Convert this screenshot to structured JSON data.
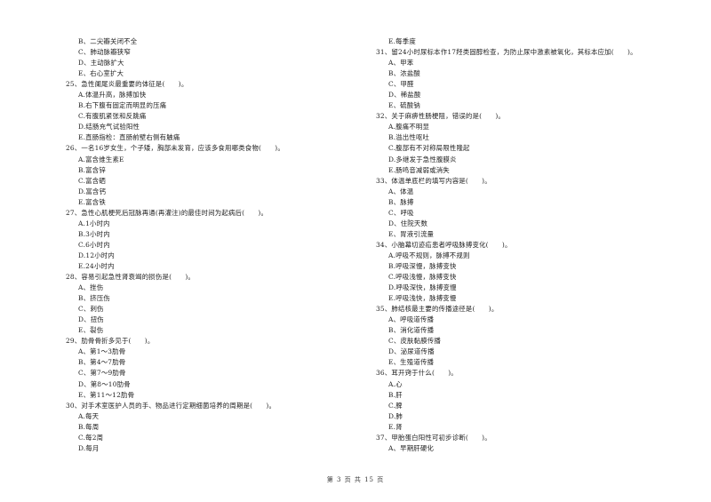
{
  "page": {
    "left_column": [
      {
        "type": "option",
        "text": "B、二尖瓣关闭不全"
      },
      {
        "type": "option",
        "text": "C、肺动脉瓣狭窄"
      },
      {
        "type": "option",
        "text": "D、主动脉扩大"
      },
      {
        "type": "option",
        "text": "E、右心室扩大"
      },
      {
        "type": "question",
        "text": "25、急性阑尾炎最重要的体征是(　　)。"
      },
      {
        "type": "option",
        "text": "A.体温升高，脉搏加快"
      },
      {
        "type": "option",
        "text": "B.右下腹有固定而明显的压痛"
      },
      {
        "type": "option",
        "text": "C.有腹肌紧张和反跳痛"
      },
      {
        "type": "option",
        "text": "D.结肠充气试验阳性"
      },
      {
        "type": "option",
        "text": "E.直肠指检：直肠前壁右侧有触痛"
      },
      {
        "type": "question",
        "text": "26、一名16岁女生，个子矮，胸部未发育，应该多食用哪类食物(　　)。"
      },
      {
        "type": "option",
        "text": "A.富含维生素E"
      },
      {
        "type": "option",
        "text": "B.富含锌"
      },
      {
        "type": "option",
        "text": "C.富含硒"
      },
      {
        "type": "option",
        "text": "D.富含钙"
      },
      {
        "type": "option",
        "text": "E.富含铁"
      },
      {
        "type": "question",
        "text": "27、急性心肌梗死后冠脉再通(再灌注)的最佳时间为起病后(　　)。"
      },
      {
        "type": "option",
        "text": "A.1小时内"
      },
      {
        "type": "option",
        "text": "B.3小时内"
      },
      {
        "type": "option",
        "text": "C.6小时内"
      },
      {
        "type": "option",
        "text": "D.12小时内"
      },
      {
        "type": "option",
        "text": "E.24小时内"
      },
      {
        "type": "question",
        "text": "28、容易引起急性肾衰竭的损伤是(　　)。"
      },
      {
        "type": "option",
        "text": "A、挫伤"
      },
      {
        "type": "option",
        "text": "B、挤压伤"
      },
      {
        "type": "option",
        "text": "C、刺伤"
      },
      {
        "type": "option",
        "text": "D、扭伤"
      },
      {
        "type": "option",
        "text": "E、裂伤"
      },
      {
        "type": "question",
        "text": "29、肋骨骨折多见于(　　)。"
      },
      {
        "type": "option",
        "text": "A、第1～3肋骨"
      },
      {
        "type": "option",
        "text": "B、第4～7肋骨"
      },
      {
        "type": "option",
        "text": "C、第7～9肋骨"
      },
      {
        "type": "option",
        "text": "D、第8～10肋骨"
      },
      {
        "type": "option",
        "text": "E、第11～12肋骨"
      },
      {
        "type": "question",
        "text": "30、对手术室医护人员的手、物品进行定期细菌培养的周期是(　　)。"
      },
      {
        "type": "option",
        "text": "A.每天"
      },
      {
        "type": "option",
        "text": "B.每周"
      },
      {
        "type": "option",
        "text": "C.每2周"
      },
      {
        "type": "option",
        "text": "D.每月"
      }
    ],
    "right_column": [
      {
        "type": "option",
        "text": "E.每季度"
      },
      {
        "type": "question",
        "text": "31、留24小时尿标本作17羟类固醇检查，为防止尿中激素被氧化，其标本应加(　　)。"
      },
      {
        "type": "option",
        "text": "A、甲苯"
      },
      {
        "type": "option",
        "text": "B、浓盐酸"
      },
      {
        "type": "option",
        "text": "C、甲醛"
      },
      {
        "type": "option",
        "text": "D、稀盐酸"
      },
      {
        "type": "option",
        "text": "E、硫酸钠"
      },
      {
        "type": "question",
        "text": "32、关于麻痹性肠梗阻，错误的是(　　)。"
      },
      {
        "type": "option",
        "text": "A.腹痛不明显"
      },
      {
        "type": "option",
        "text": "B.溢出性呕吐"
      },
      {
        "type": "option",
        "text": "C.腹部有不对称局限性隆起"
      },
      {
        "type": "option",
        "text": "D.多继发于急性腹膜炎"
      },
      {
        "type": "option",
        "text": "E.肠鸣音减弱或消失"
      },
      {
        "type": "question",
        "text": "33、体温单底栏的填写内容是(　　)。"
      },
      {
        "type": "option",
        "text": "A、体温"
      },
      {
        "type": "option",
        "text": "B、脉搏"
      },
      {
        "type": "option",
        "text": "C、呼吸"
      },
      {
        "type": "option",
        "text": "D、住院天数"
      },
      {
        "type": "option",
        "text": "E、胃液引流量"
      },
      {
        "type": "question",
        "text": "34、小脑幕切迹疝患者呼吸脉搏变化(　　)。"
      },
      {
        "type": "option",
        "text": "A.呼吸不规则，脉搏不规则"
      },
      {
        "type": "option",
        "text": "B.呼吸深慢，脉搏变快"
      },
      {
        "type": "option",
        "text": "C.呼吸浅慢，脉搏变快"
      },
      {
        "type": "option",
        "text": "D.呼吸深快，脉搏变慢"
      },
      {
        "type": "option",
        "text": "E.呼吸浅快，脉搏变慢"
      },
      {
        "type": "question",
        "text": "35、肺结核最主要的传播途径是(　　)。"
      },
      {
        "type": "option",
        "text": "A、呼吸道传播"
      },
      {
        "type": "option",
        "text": "B、消化道传播"
      },
      {
        "type": "option",
        "text": "C、皮肤黏膜传播"
      },
      {
        "type": "option",
        "text": "D、泌尿道传播"
      },
      {
        "type": "option",
        "text": "E、生殖道传播"
      },
      {
        "type": "question",
        "text": "36、耳开窍于什么(　　)。"
      },
      {
        "type": "option",
        "text": "A.心"
      },
      {
        "type": "option",
        "text": "B.肝"
      },
      {
        "type": "option",
        "text": "C.脾"
      },
      {
        "type": "option",
        "text": "D.肺"
      },
      {
        "type": "option",
        "text": "E.肾"
      },
      {
        "type": "question",
        "text": "37、甲胎蛋白阳性可初步诊断(　　)。"
      },
      {
        "type": "option",
        "text": "A、早期肝硬化"
      }
    ],
    "footer": "第 3 页 共 15 页"
  }
}
